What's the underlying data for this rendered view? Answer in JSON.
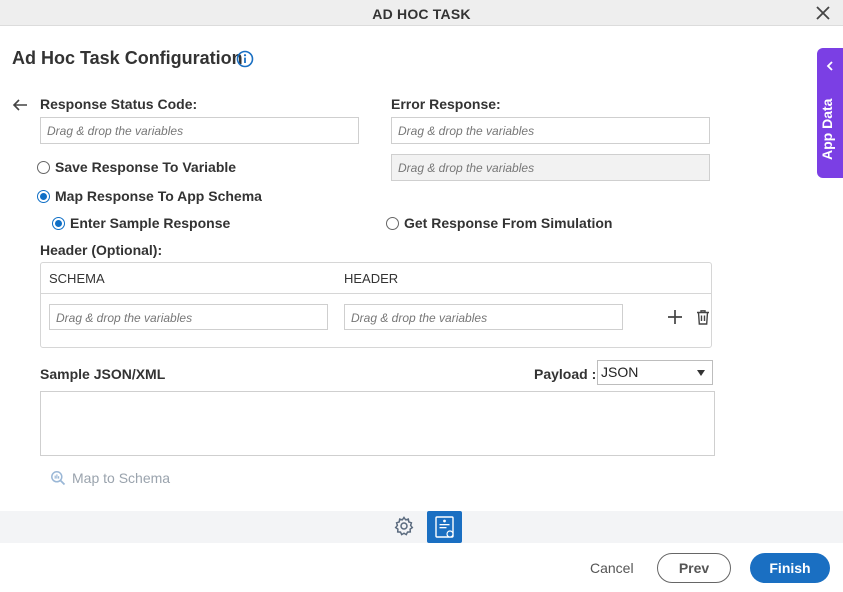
{
  "window": {
    "title": "AD HOC TASK",
    "close_icon": "close-icon"
  },
  "page": {
    "title": "Ad Hoc Task Configuration",
    "info_icon": "info-icon"
  },
  "response_status": {
    "label": "Response Status Code:",
    "placeholder": "Drag & drop the variables"
  },
  "error_response": {
    "label": "Error Response:",
    "placeholder": "Drag & drop the variables",
    "variable_placeholder": "Drag & drop the variables"
  },
  "options": {
    "save_to_variable": {
      "label": "Save Response To Variable",
      "checked": false
    },
    "map_to_schema": {
      "label": "Map Response To App Schema",
      "checked": true
    },
    "enter_sample": {
      "label": "Enter Sample Response",
      "checked": true
    },
    "from_simulation": {
      "label": "Get Response From Simulation",
      "checked": false
    }
  },
  "header_table": {
    "label": "Header (Optional):",
    "columns": [
      "SCHEMA",
      "HEADER"
    ],
    "rows": [
      {
        "schema_placeholder": "Drag & drop the variables",
        "header_placeholder": "Drag & drop the variables"
      }
    ],
    "add_icon": "plus-icon",
    "delete_icon": "trash-icon"
  },
  "sample": {
    "label": "Sample JSON/XML",
    "payload_label": "Payload :",
    "payload_value": "JSON",
    "map_to_schema": "Map to Schema"
  },
  "toolbar": {
    "settings_icon": "gear-icon",
    "active_icon": "form-icon"
  },
  "footer": {
    "cancel": "Cancel",
    "prev": "Prev",
    "finish": "Finish"
  },
  "side_panel": {
    "label": "App Data",
    "icon": "chevron-left-icon"
  },
  "colors": {
    "accent": "#1a6fc2",
    "side_tab": "#7b3fe4",
    "radio": "#0f6fc6",
    "disabled_link": "#9aa3ad"
  }
}
